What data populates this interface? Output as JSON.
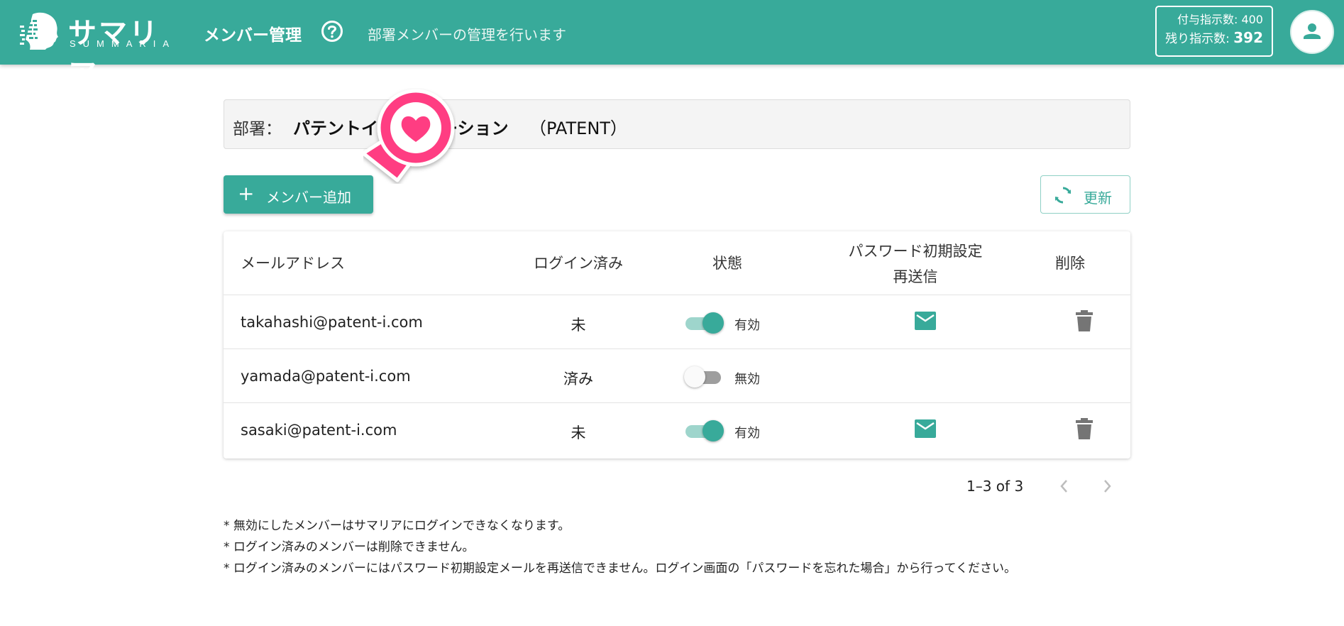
{
  "header": {
    "logo_text": "サマリア",
    "logo_sub": "SUMMARIA",
    "title": "メンバー管理",
    "description": "部署メンバーの管理を行います",
    "quota_granted": "付与指示数: 400",
    "quota_remaining_label": "残り指示数:",
    "quota_remaining_value": "392"
  },
  "department": {
    "label": "部署：",
    "name": "パテントイ",
    "name_tail": "ーション",
    "code": "（PATENT）"
  },
  "actions": {
    "add_label": "メンバー追加",
    "refresh_label": "更新"
  },
  "table": {
    "headers": {
      "email": "メールアドレス",
      "logged_in": "ログイン済み",
      "status": "状態",
      "resend_line1": "パスワード初期設定",
      "resend_line2": "再送信",
      "delete": "削除"
    },
    "rows": [
      {
        "email": "takahashi@patent-i.com",
        "logged_in": "未",
        "enabled": true,
        "status_label": "有効",
        "can_resend": true,
        "can_delete": true
      },
      {
        "email": "yamada@patent-i.com",
        "logged_in": "済み",
        "enabled": false,
        "status_label": "無効",
        "can_resend": false,
        "can_delete": false
      },
      {
        "email": "sasaki@patent-i.com",
        "logged_in": "未",
        "enabled": true,
        "status_label": "有効",
        "can_resend": true,
        "can_delete": true
      }
    ]
  },
  "pagination": {
    "range": "1–3 of 3"
  },
  "notes": [
    "* 無効にしたメンバーはサマリアにログインできなくなります。",
    "* ログイン済みのメンバーは削除できません。",
    "* ログイン済みのメンバーにはパスワード初期設定メールを再送信できません。ログイン画面の「パスワードを忘れた場合」から行ってください。"
  ],
  "colors": {
    "primary": "#38aa9a",
    "marker": "#ff3d82"
  }
}
